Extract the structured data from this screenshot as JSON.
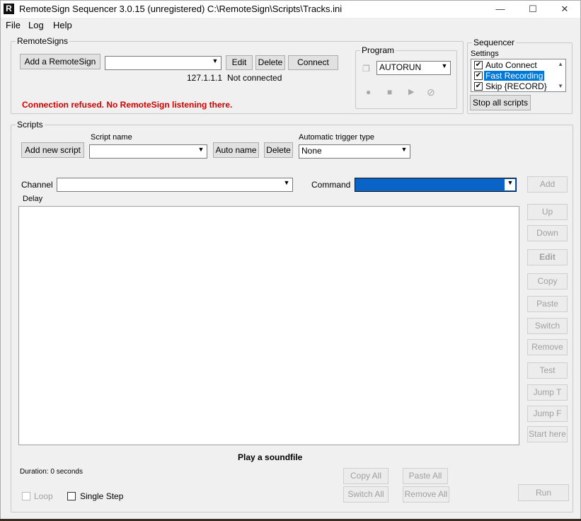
{
  "window": {
    "app_icon": "R",
    "title": "RemoteSign Sequencer 3.0.15 (unregistered) C:\\RemoteSign\\Scripts\\Tracks.ini",
    "minimize": "—",
    "maximize": "☐",
    "close": "✕"
  },
  "menu": [
    "File",
    "Log",
    "Help"
  ],
  "remotesigns": {
    "group_label": "RemoteSigns",
    "add_button": "Add a RemoteSign",
    "combo_value": "",
    "edit_button": "Edit",
    "delete_button": "Delete",
    "connect_button": "Connect",
    "ip": "127.1.1.1",
    "status": "Not connected",
    "error": "Connection refused. No RemoteSign listening there."
  },
  "program": {
    "group_label": "Program",
    "combo_value": "AUTORUN",
    "icons": [
      "window-icon",
      "record-icon",
      "stop-icon",
      "play-icon",
      "cancel-icon"
    ]
  },
  "sequencer": {
    "group_label": "Sequencer",
    "settings_label": "Settings",
    "settings": [
      {
        "label": "Auto Connect",
        "checked": true,
        "selected": false
      },
      {
        "label": "Fast Recording",
        "checked": true,
        "selected": true
      },
      {
        "label": "Skip {RECORD}",
        "checked": true,
        "selected": false
      }
    ],
    "stop_all_button": "Stop all scripts"
  },
  "scripts": {
    "group_label": "Scripts",
    "add_new_button": "Add new script",
    "script_name_label": "Script name",
    "script_name_value": "",
    "auto_name_button": "Auto name",
    "delete_button": "Delete",
    "trigger_label": "Automatic trigger type",
    "trigger_value": "None",
    "channel_label": "Channel",
    "channel_value": "",
    "command_label": "Command",
    "command_value": "",
    "delay_label": "Delay",
    "add_button": "Add",
    "side_buttons": [
      "Up",
      "Down",
      "Edit",
      "Copy",
      "Paste",
      "Switch",
      "Remove",
      "Test",
      "Jump T",
      "Jump F",
      "Start here"
    ],
    "description": "Play a soundfile",
    "duration": "Duration: 0 seconds",
    "copy_all": "Copy All",
    "paste_all": "Paste All",
    "switch_all": "Switch All",
    "remove_all": "Remove All",
    "loop_label": "Loop",
    "single_step_label": "Single Step",
    "run_button": "Run"
  },
  "colors": {
    "error": "#d00000",
    "selection": "#0078d7",
    "command_highlight": "#0a64c8"
  }
}
